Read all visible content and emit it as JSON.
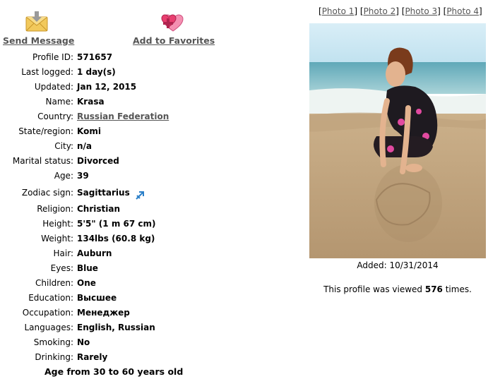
{
  "actions": {
    "send_message": "Send Message",
    "add_favorites": "Add to Favorites"
  },
  "profile": [
    {
      "label": "Profile ID:",
      "value": "571657"
    },
    {
      "label": "Last logged:",
      "value": "1 day(s)"
    },
    {
      "label": "Updated:",
      "value": "Jan 12, 2015"
    },
    {
      "label": "Name:",
      "value": "Krasa"
    },
    {
      "label": "Country:",
      "value": "Russian Federation"
    },
    {
      "label": "State/region:",
      "value": "Komi"
    },
    {
      "label": "City:",
      "value": "n/a"
    },
    {
      "label": "Marital status:",
      "value": "Divorced"
    },
    {
      "label": "Age:",
      "value": "39"
    },
    {
      "label": "Zodiac sign:",
      "value": "Sagittarius"
    },
    {
      "label": "Religion:",
      "value": "Christian"
    },
    {
      "label": "Height:",
      "value": "5'5\" (1 m 67 cm)"
    },
    {
      "label": "Weight:",
      "value": "134lbs (60.8 kg)"
    },
    {
      "label": "Hair:",
      "value": "Auburn"
    },
    {
      "label": "Eyes:",
      "value": "Blue"
    },
    {
      "label": "Children:",
      "value": "One"
    },
    {
      "label": "Education:",
      "value": "Высшее"
    },
    {
      "label": "Occupation:",
      "value": "Менеджер"
    },
    {
      "label": "Languages:",
      "value": "English, Russian"
    },
    {
      "label": "Smoking:",
      "value": "No"
    },
    {
      "label": "Drinking:",
      "value": "Rarely"
    }
  ],
  "age_range": "Age from 30 to 60 years old",
  "photo_links": [
    "Photo 1",
    "Photo 2",
    "Photo 3",
    "Photo 4"
  ],
  "added": "Added: 10/31/2014",
  "views": {
    "prefix": "This profile was viewed ",
    "count": "576",
    "suffix": " times."
  },
  "icons": {
    "send_message": "envelope-icon",
    "add_favorites": "hearts-plus-icon",
    "zodiac": "sagittarius-icon"
  },
  "colors": {
    "link": "#555555",
    "text": "#000000"
  }
}
